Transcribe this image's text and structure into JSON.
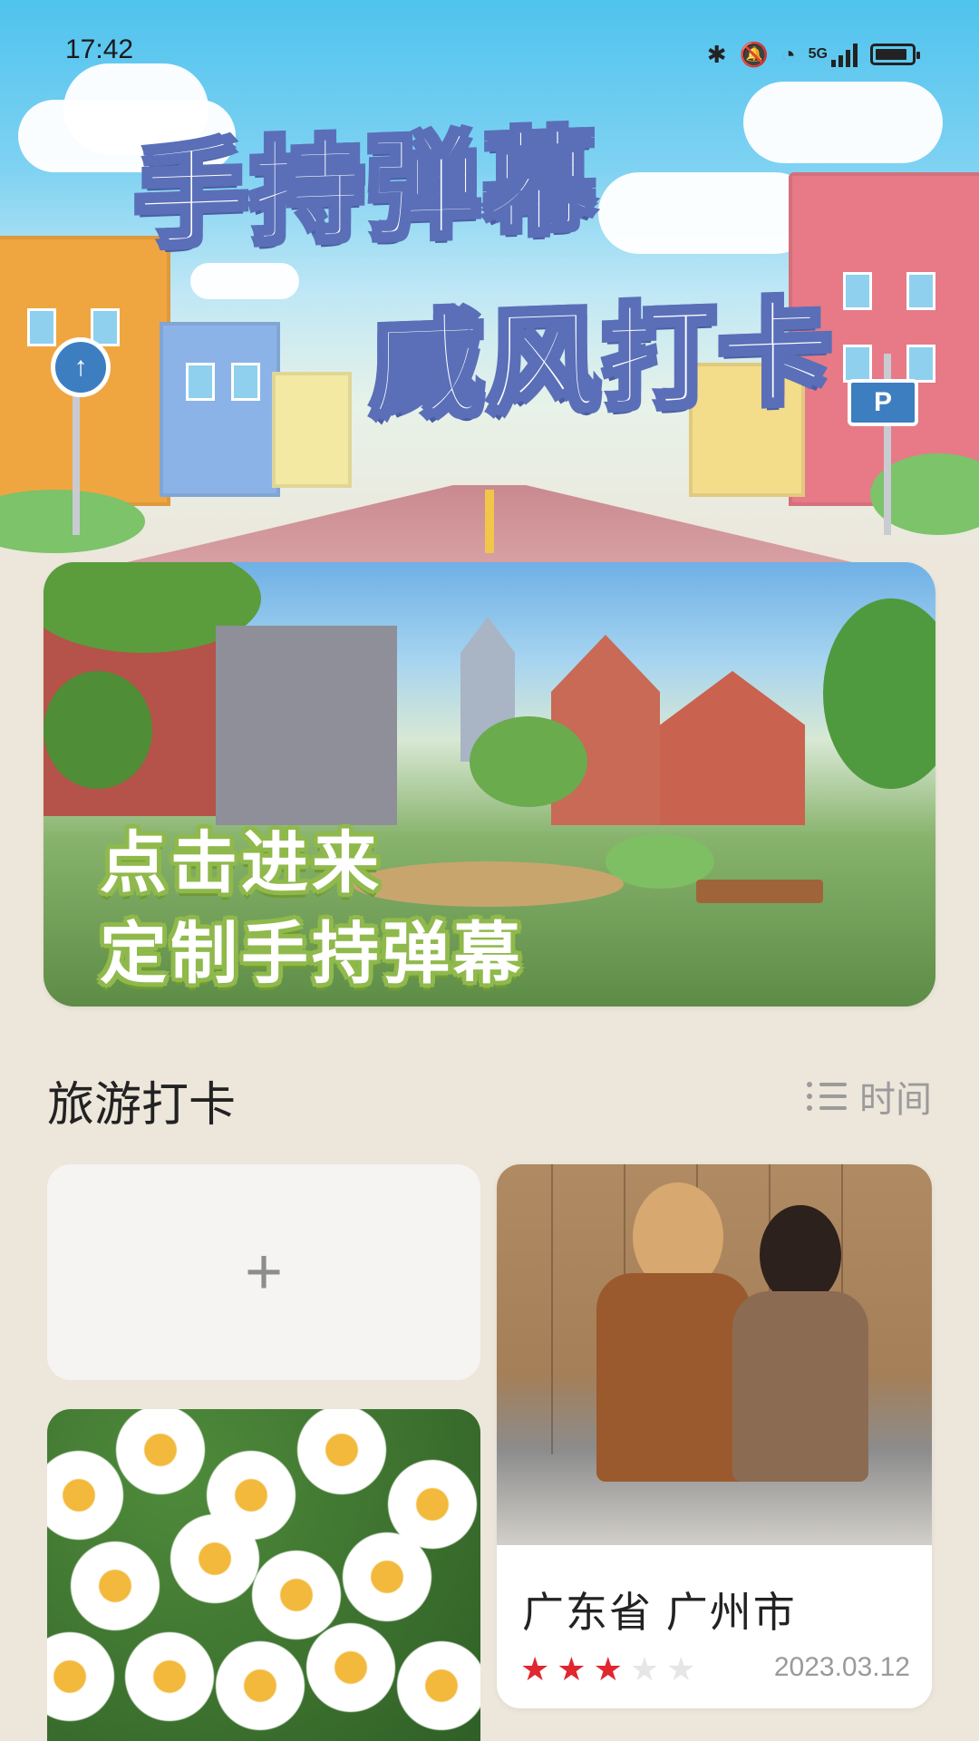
{
  "status_bar": {
    "time": "17:42",
    "network": "5G",
    "icons": [
      "bluetooth-icon",
      "mute-icon",
      "wifi-icon",
      "signal-icon",
      "battery-icon"
    ]
  },
  "hero": {
    "title_line1": "手持弹幕",
    "title_line2": "威风打卡",
    "sign_left": "↑",
    "sign_right": "P"
  },
  "banner": {
    "line1": "点击进来",
    "line2": "定制手持弹幕"
  },
  "section": {
    "title": "旅游打卡",
    "sort_label": "时间"
  },
  "add_card": {
    "plus": "+"
  },
  "checkins": [
    {
      "location": "广东省 广州市",
      "rating": 3,
      "rating_max": 5,
      "date": "2023.03.12"
    }
  ],
  "colors": {
    "background": "#ece6db",
    "title_outline": "#5a6fb8",
    "banner_text_outline": "#8fb94b",
    "star_active": "#e0262f",
    "star_inactive": "#e6e6e6"
  }
}
